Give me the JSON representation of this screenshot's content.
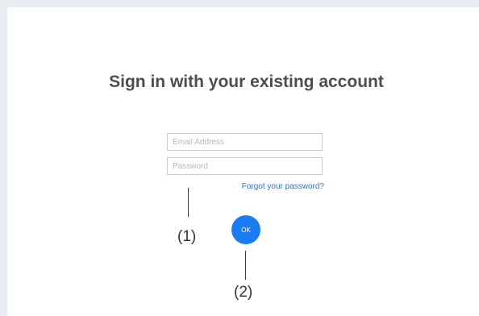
{
  "signin": {
    "title": "Sign in with your existing account",
    "email_placeholder": "Email Address",
    "password_placeholder": "Password",
    "forgot_link": "Forgot your password?",
    "ok_label": "OK"
  },
  "callouts": {
    "one": "(1)",
    "two": "(2)"
  },
  "colors": {
    "page_background": "#e8ebf0",
    "panel_background": "#ffffff",
    "heading_text": "#4b4d52",
    "link": "#1d73d8",
    "primary_button": "#1a7bf2"
  }
}
